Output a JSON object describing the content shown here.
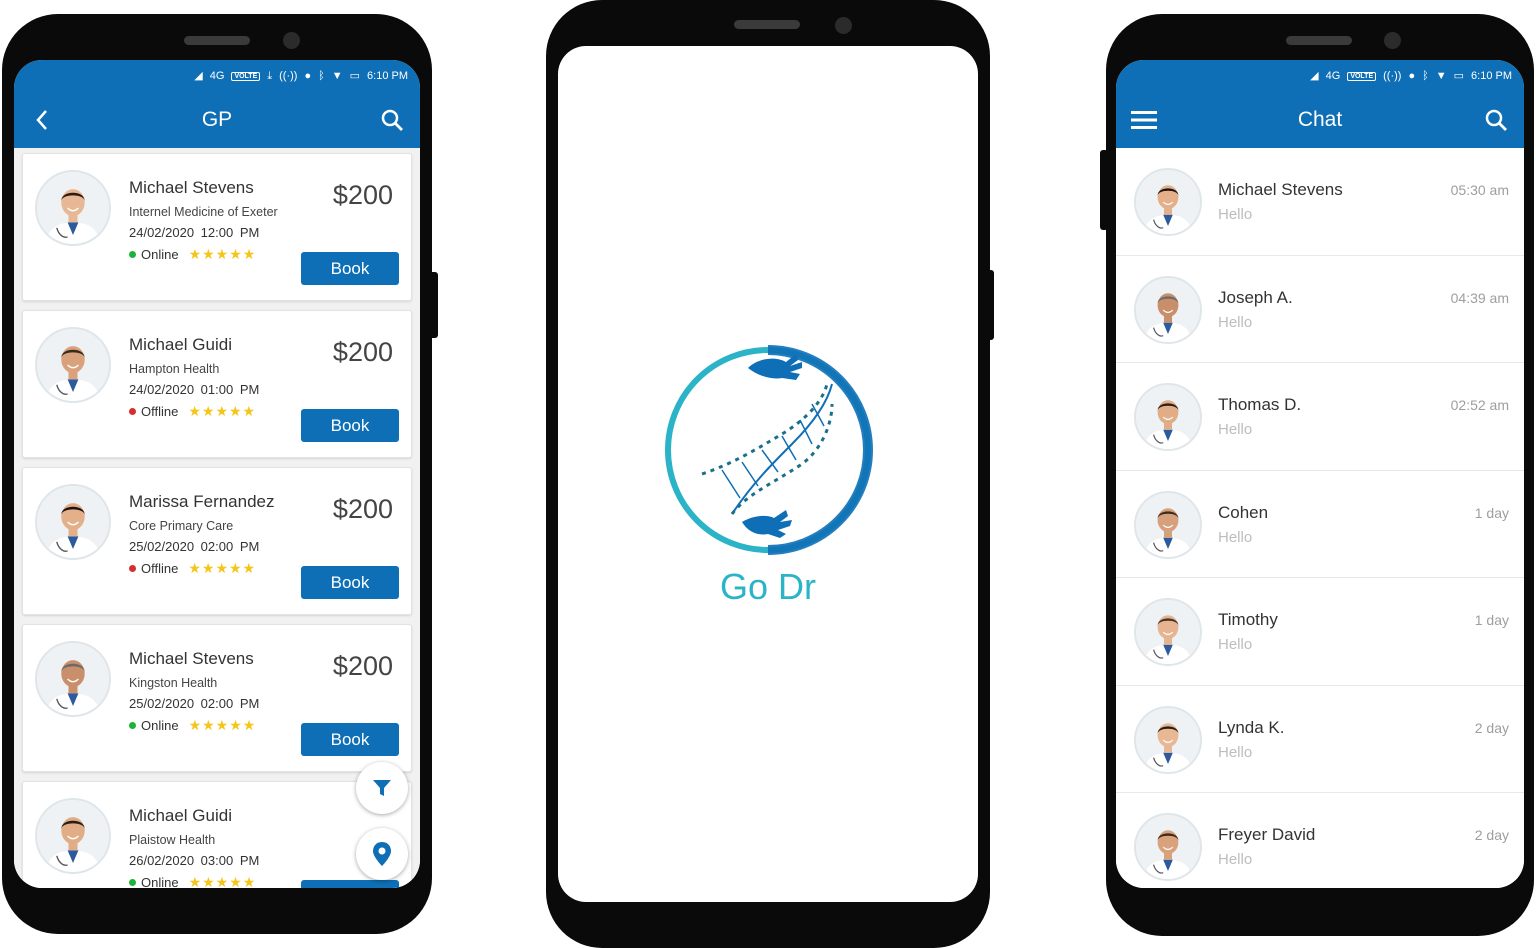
{
  "colors": {
    "primary": "#0e6fb6",
    "online": "#1db33a",
    "offline": "#d32f2f",
    "star": "#f5c518",
    "logo": "#2bb3c7"
  },
  "status_bar": {
    "network": "4G",
    "volte": "VOLTE",
    "time": "6:10 PM"
  },
  "gp_screen": {
    "title": "GP",
    "back_icon": "chevron-left-icon",
    "search_icon": "search-icon",
    "doctors": [
      {
        "name": "Michael Stevens",
        "practice": "Internel Medicine of Exeter",
        "date": "24/02/2020",
        "time": "12:00 PM",
        "status": "Online",
        "rating": 5,
        "price": "$200",
        "book_label": "Book"
      },
      {
        "name": "Michael Guidi",
        "practice": "Hampton Health",
        "date": "24/02/2020",
        "time": "01:00 PM",
        "status": "Offline",
        "rating": 5,
        "price": "$200",
        "book_label": "Book"
      },
      {
        "name": "Marissa Fernandez",
        "practice": "Core Primary Care",
        "date": "25/02/2020",
        "time": "02:00 PM",
        "status": "Offline",
        "rating": 5,
        "price": "$200",
        "book_label": "Book"
      },
      {
        "name": "Michael Stevens",
        "practice": "Kingston Health",
        "date": "25/02/2020",
        "time": "02:00 PM",
        "status": "Online",
        "rating": 5,
        "price": "$200",
        "book_label": "Book"
      },
      {
        "name": "Michael Guidi",
        "practice": "Plaistow Health",
        "date": "26/02/2020",
        "time": "03:00 PM",
        "status": "Online",
        "rating": 5,
        "price": "",
        "book_label": ""
      }
    ],
    "fab_filter_icon": "filter-icon",
    "fab_location_icon": "location-pin-icon"
  },
  "splash_screen": {
    "app_name": "Go Dr",
    "logo_icon": "dna-hands-logo"
  },
  "chat_screen": {
    "title": "Chat",
    "menu_icon": "hamburger-menu-icon",
    "search_icon": "search-icon",
    "chats": [
      {
        "name": "Michael Stevens",
        "message": "Hello",
        "time": "05:30 am"
      },
      {
        "name": "Joseph A.",
        "message": "Hello",
        "time": "04:39 am"
      },
      {
        "name": "Thomas D.",
        "message": "Hello",
        "time": "02:52 am"
      },
      {
        "name": "Cohen",
        "message": "Hello",
        "time": "1 day"
      },
      {
        "name": "Timothy",
        "message": "Hello",
        "time": "1 day"
      },
      {
        "name": "Lynda K.",
        "message": "Hello",
        "time": "2 day"
      },
      {
        "name": "Freyer David",
        "message": "Hello",
        "time": "2 day"
      }
    ]
  }
}
